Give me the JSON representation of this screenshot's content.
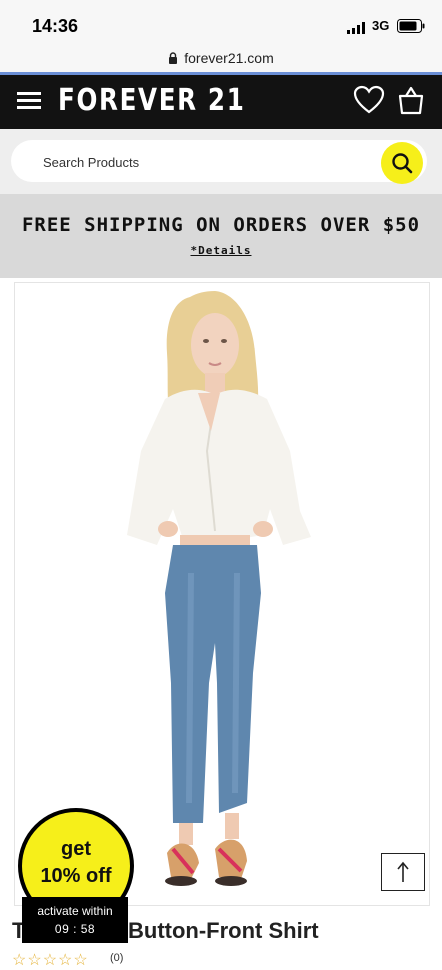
{
  "status_bar": {
    "time": "14:36",
    "network": "3G",
    "icons": [
      "signal-icon",
      "battery-icon"
    ]
  },
  "browser": {
    "url": "forever21.com",
    "icon": "lock-icon"
  },
  "header": {
    "logo": "FOREVER 21",
    "icons": [
      "menu-icon",
      "heart-icon",
      "shopping-bag-icon"
    ],
    "background_color": "#121212"
  },
  "search": {
    "placeholder": "Search Products",
    "button_icon": "search-icon",
    "accent_color": "#f6ef1a"
  },
  "promo": {
    "title": "FREE SHIPPING ON ORDERS OVER $50",
    "link": "*Details"
  },
  "product": {
    "title_first": "T",
    "title_visible": "Button-Front Shirt",
    "rating_stars": "☆☆☆☆☆",
    "review_count": "(0)"
  },
  "discount_popup": {
    "line1": "get",
    "line2": "10% off",
    "activate_label": "activate within",
    "timer": "09 : 58"
  },
  "scroll_top": {
    "icon": "arrow-up-icon"
  }
}
